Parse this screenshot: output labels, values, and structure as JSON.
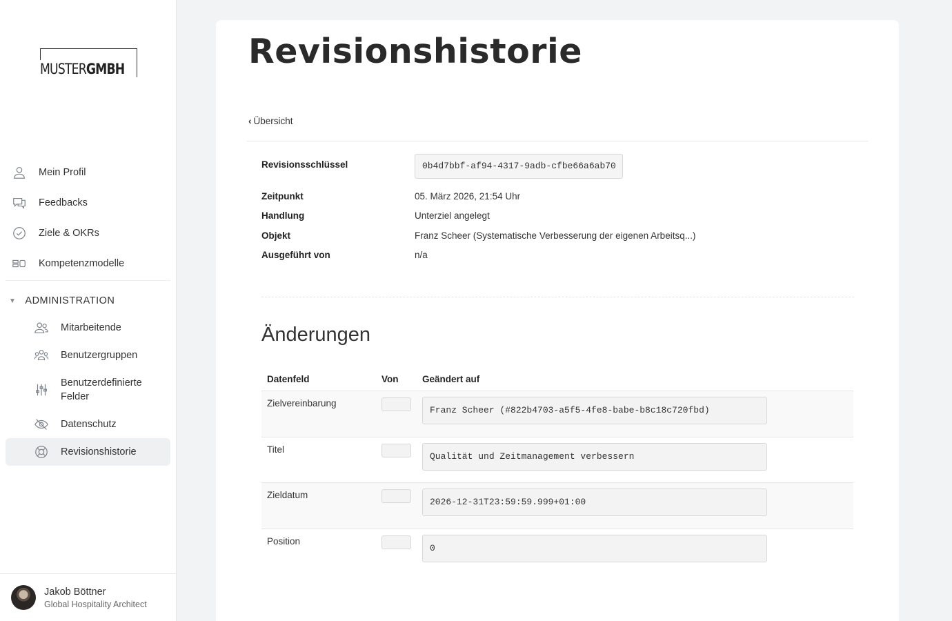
{
  "brand": {
    "logo_light": "MUSTER",
    "logo_bold": "GMBH"
  },
  "sidebar": {
    "items": [
      {
        "label": "Mein Profil",
        "icon": "person-icon"
      },
      {
        "label": "Feedbacks",
        "icon": "chat-icon"
      },
      {
        "label": "Ziele & OKRs",
        "icon": "check-circle-icon"
      },
      {
        "label": "Kompetenzmodelle",
        "icon": "model-icon"
      }
    ],
    "section_label": "ADMINISTRATION",
    "admin_items": [
      {
        "label": "Mitarbeitende",
        "icon": "people-icon"
      },
      {
        "label": "Benutzergruppen",
        "icon": "group-icon"
      },
      {
        "label": "Benutzerdefinierte Felder",
        "icon": "sliders-icon"
      },
      {
        "label": "Datenschutz",
        "icon": "eye-off-icon"
      },
      {
        "label": "Revisionshistorie",
        "icon": "lifebuoy-icon",
        "active": true
      }
    ]
  },
  "user": {
    "name": "Jakob Böttner",
    "role": "Global Hospitality Architect"
  },
  "page": {
    "title": "Revisionshistorie",
    "back_label": "Übersicht"
  },
  "meta": {
    "key_label": "Revisionsschlüssel",
    "key_value": "0b4d7bbf-af94-4317-9adb-cfbe66a6ab70",
    "time_label": "Zeitpunkt",
    "time_value": "05. März 2026, 21:54 Uhr",
    "action_label": "Handlung",
    "action_value": "Unterziel angelegt",
    "object_label": "Objekt",
    "object_value": "Franz Scheer (Systematische Verbesserung der eigenen Arbeitsq...)",
    "by_label": "Ausgeführt von",
    "by_value": "n/a"
  },
  "changes": {
    "title": "Änderungen",
    "headers": {
      "field": "Datenfeld",
      "from": "Von",
      "to": "Geändert auf"
    },
    "rows": [
      {
        "field": "Zielvereinbarung",
        "from": "",
        "to": "Franz Scheer (#822b4703-a5f5-4fe8-babe-b8c18c720fbd)"
      },
      {
        "field": "Titel",
        "from": "",
        "to": "Qualität und Zeitmanagement verbessern"
      },
      {
        "field": "Zieldatum",
        "from": "",
        "to": "2026-12-31T23:59:59.999+01:00"
      },
      {
        "field": "Position",
        "from": "",
        "to": "0"
      }
    ]
  }
}
